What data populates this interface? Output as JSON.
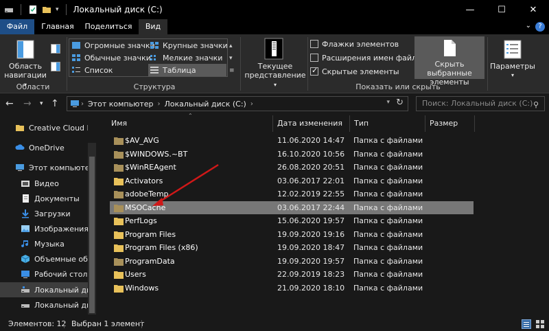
{
  "window": {
    "title": "Локальный диск (C:)",
    "minimize": "—",
    "maximize": "☐",
    "close": "✕"
  },
  "tabs": [
    {
      "label": "Файл"
    },
    {
      "label": "Главная"
    },
    {
      "label": "Поделиться"
    },
    {
      "label": "Вид"
    }
  ],
  "ribbon": {
    "nav_pane_label_1": "Область",
    "nav_pane_label_2": "навигации",
    "group_areas": "Области",
    "layout": {
      "huge_icons": "Огромные значки",
      "normal_icons": "Обычные значки",
      "list": "Список",
      "large_icons": "Крупные значки",
      "small_icons": "Мелкие значки",
      "table": "Таблица"
    },
    "group_structure": "Структура",
    "current_view_1": "Текущее",
    "current_view_2": "представление",
    "checkboxes": [
      {
        "label": "Флажки элементов",
        "checked": false
      },
      {
        "label": "Расширения имен файлов",
        "checked": false
      },
      {
        "label": "Скрытые элементы",
        "checked": true
      }
    ],
    "hide_selected_1": "Скрыть выбранные",
    "hide_selected_2": "элементы",
    "group_show_hide": "Показать или скрыть",
    "options": "Параметры"
  },
  "address": {
    "crumbs": [
      "Этот компьютер",
      "Локальный диск (C:)"
    ],
    "search_placeholder": "Поиск: Локальный диск (C:)"
  },
  "sidebar": {
    "items": [
      {
        "label": "Creative Cloud Fil",
        "icon": "folder-icon"
      },
      {
        "label": "OneDrive",
        "icon": "cloud-icon"
      },
      {
        "label": "Этот компьютер",
        "icon": "computer-icon"
      },
      {
        "label": "Видео",
        "icon": "video-icon"
      },
      {
        "label": "Документы",
        "icon": "documents-icon"
      },
      {
        "label": "Загрузки",
        "icon": "download-icon"
      },
      {
        "label": "Изображения",
        "icon": "images-icon"
      },
      {
        "label": "Музыка",
        "icon": "music-icon"
      },
      {
        "label": "Объемные объ",
        "icon": "3d-objects-icon"
      },
      {
        "label": "Рабочий стол",
        "icon": "desktop-icon"
      },
      {
        "label": "Локальный дис",
        "icon": "drive-icon",
        "selected": true
      },
      {
        "label": "Локальный дис",
        "icon": "drive-icon"
      }
    ]
  },
  "columns": {
    "name": "Имя",
    "date": "Дата изменения",
    "type": "Тип",
    "size": "Размер"
  },
  "files": [
    {
      "name": "$AV_AVG",
      "date": "11.06.2020 14:47",
      "type": "Папка с файлами",
      "hidden": true
    },
    {
      "name": "$WINDOWS.~BT",
      "date": "16.10.2020 10:56",
      "type": "Папка с файлами",
      "hidden": true
    },
    {
      "name": "$WinREAgent",
      "date": "26.08.2020 20:51",
      "type": "Папка с файлами",
      "hidden": true
    },
    {
      "name": "Activators",
      "date": "03.06.2017 22:01",
      "type": "Папка с файлами",
      "hidden": false
    },
    {
      "name": "adobeTemp",
      "date": "12.02.2019 22:55",
      "type": "Папка с файлами",
      "hidden": true
    },
    {
      "name": "MSOCache",
      "date": "03.06.2017 22:44",
      "type": "Папка с файлами",
      "hidden": true,
      "selected": true
    },
    {
      "name": "PerfLogs",
      "date": "15.06.2020 19:57",
      "type": "Папка с файлами",
      "hidden": false
    },
    {
      "name": "Program Files",
      "date": "19.09.2020 19:16",
      "type": "Папка с файлами",
      "hidden": false
    },
    {
      "name": "Program Files (x86)",
      "date": "19.09.2020 18:47",
      "type": "Папка с файлами",
      "hidden": false
    },
    {
      "name": "ProgramData",
      "date": "19.09.2020 19:57",
      "type": "Папка с файлами",
      "hidden": true
    },
    {
      "name": "Users",
      "date": "22.09.2019 18:23",
      "type": "Папка с файлами",
      "hidden": false
    },
    {
      "name": "Windows",
      "date": "21.09.2020 18:10",
      "type": "Папка с файлами",
      "hidden": false
    }
  ],
  "status": {
    "count": "Элементов: 12",
    "selected": "Выбран 1 элемент"
  },
  "colors": {
    "folder": "#e8c15a",
    "hidden_folder": "#a8905a",
    "accent": "#1e4e87",
    "annotation_arrow": "#d01818"
  }
}
